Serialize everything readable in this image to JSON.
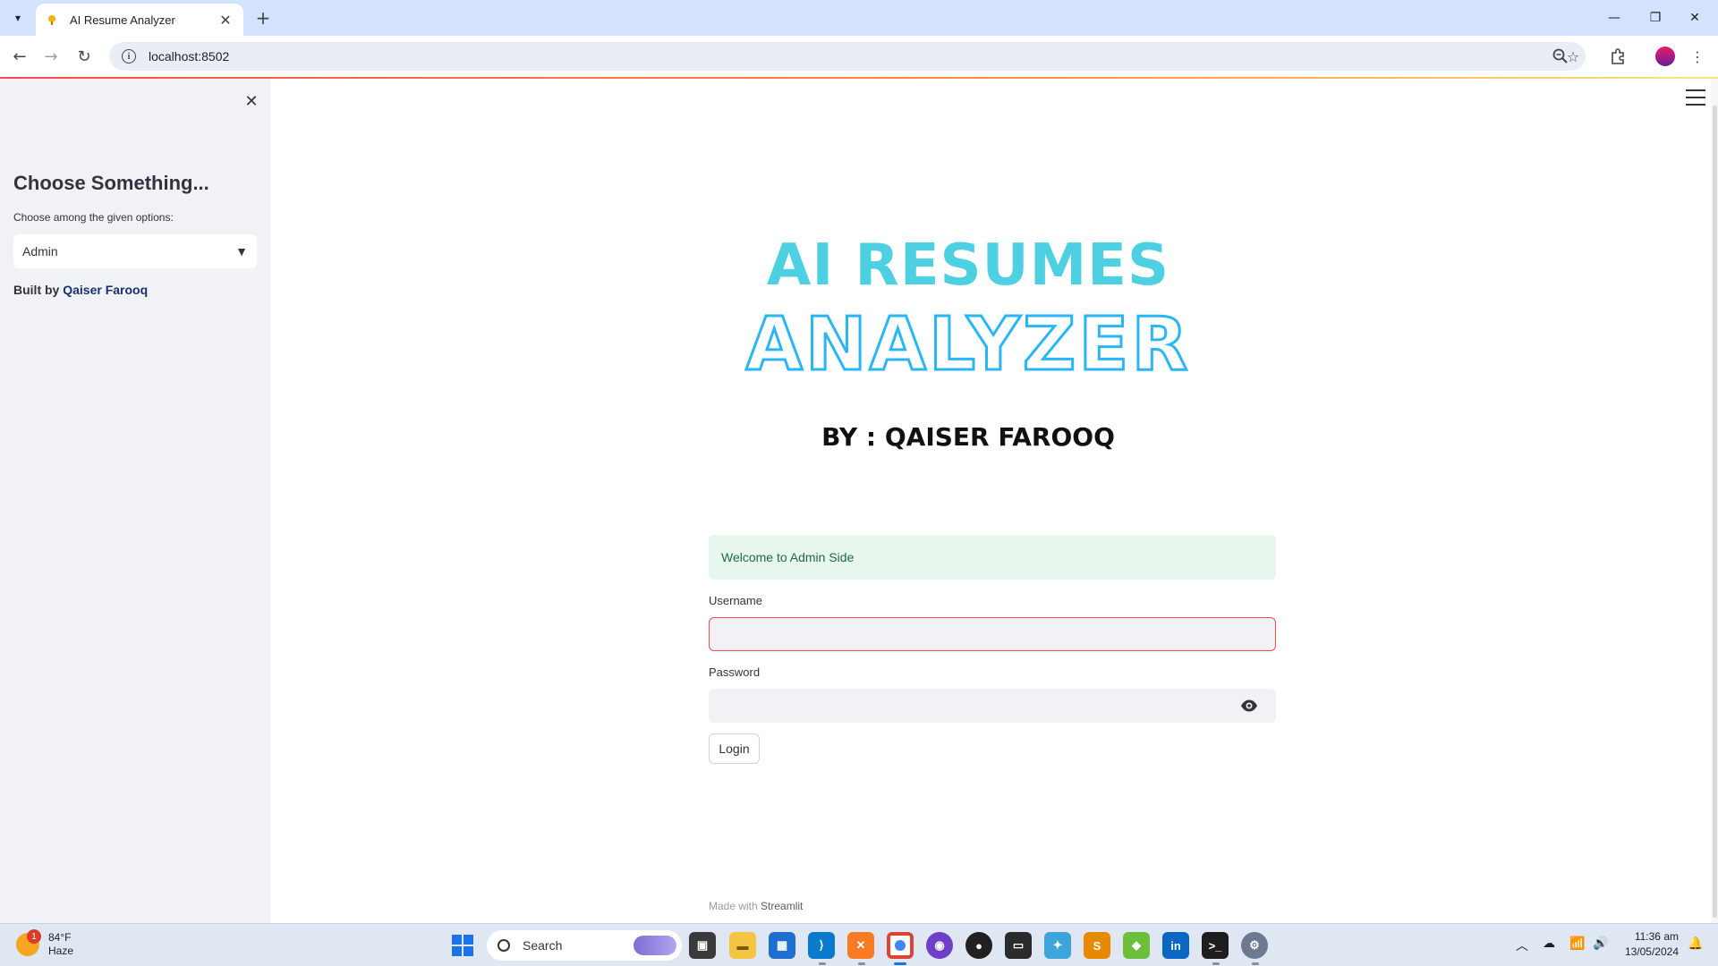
{
  "browser": {
    "tab_title": "AI Resume Analyzer",
    "url": "localhost:8502"
  },
  "sidebar": {
    "title": "Choose Something...",
    "select_label": "Choose among the given options:",
    "selected_option": "Admin",
    "built_by_prefix": "Built by",
    "built_by_name": "Qaiser Farooq"
  },
  "main": {
    "heading_line1": "AI RESUMES",
    "heading_line2": "ANALYZER",
    "byline": "BY : QAISER FAROOQ",
    "welcome_message": "Welcome to Admin Side",
    "username_label": "Username",
    "username_value": "",
    "password_label": "Password",
    "password_value": "",
    "login_button": "Login",
    "footer_prefix": "Made with",
    "footer_brand": "Streamlit"
  },
  "taskbar": {
    "weather_temp": "84°F",
    "weather_desc": "Haze",
    "weather_badge": "1",
    "search_placeholder": "Search",
    "time": "11:36 am",
    "date": "13/05/2024",
    "apps": [
      "task-view",
      "file-explorer",
      "microsoft-store",
      "vscode",
      "xampp",
      "chrome",
      "github-desktop",
      "obs",
      "terminal",
      "network-tool",
      "sublime-text",
      "bluestacks",
      "linkedin",
      "cmd",
      "settings"
    ]
  },
  "colors": {
    "heading_cyan": "#4dd0e1",
    "outline_blue": "#29b6f6",
    "streamlit_red": "#ff4b4b",
    "success_bg": "#e8f7ee",
    "sidebar_bg": "#f0f2f6"
  }
}
